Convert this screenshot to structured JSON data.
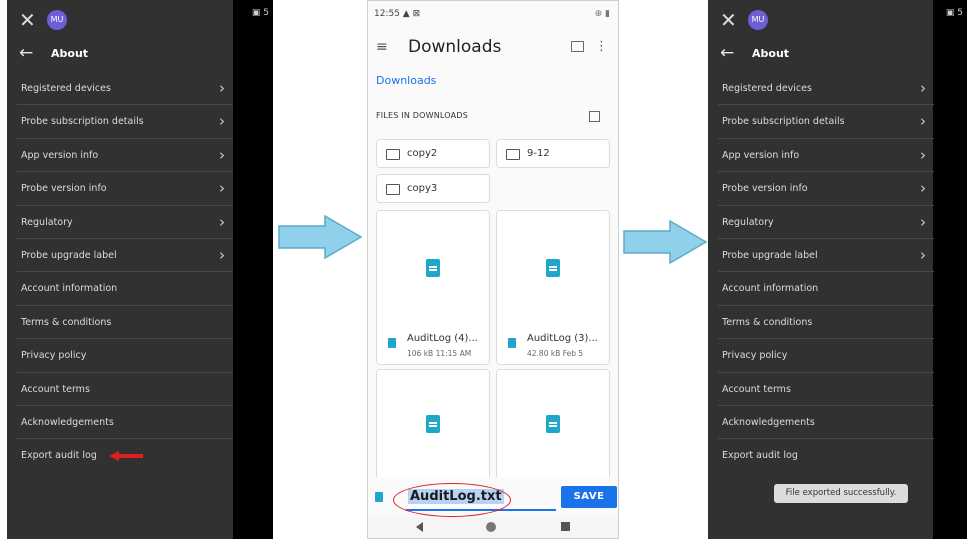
{
  "left_phone": {
    "avatar": "MU",
    "status_mini": "5",
    "title": "About",
    "items": [
      {
        "label": "Registered devices",
        "chevron": true
      },
      {
        "label": "Probe subscription details",
        "chevron": true
      },
      {
        "label": "App version info",
        "chevron": true
      },
      {
        "label": "Probe version info",
        "chevron": true
      },
      {
        "label": "Regulatory",
        "chevron": true
      },
      {
        "label": "Probe upgrade label",
        "chevron": true
      },
      {
        "label": "Account information",
        "chevron": false
      },
      {
        "label": "Terms & conditions",
        "chevron": false
      },
      {
        "label": "Privacy policy",
        "chevron": false
      },
      {
        "label": "Account terms",
        "chevron": false
      },
      {
        "label": "Acknowledgements",
        "chevron": false
      },
      {
        "label": "Export audit log",
        "chevron": false
      }
    ]
  },
  "middle_phone": {
    "time": "12:55",
    "status_right": "⊕ ▮",
    "title": "Downloads",
    "breadcrumb": "Downloads",
    "section_label": "FILES IN DOWNLOADS",
    "folders": [
      "copy2",
      "9-12",
      "copy3"
    ],
    "files": [
      {
        "name": "AuditLog (4)...",
        "meta": "106 kB 11:15 AM"
      },
      {
        "name": "AuditLog (3)...",
        "meta": "42.80 kB Feb 5"
      }
    ],
    "filename_input": "AuditLog.txt",
    "save_label": "SAVE"
  },
  "right_phone": {
    "avatar": "MU",
    "status_mini": "5",
    "title": "About",
    "items": [
      {
        "label": "Registered devices",
        "chevron": true
      },
      {
        "label": "Probe subscription details",
        "chevron": true
      },
      {
        "label": "App version info",
        "chevron": true
      },
      {
        "label": "Probe version info",
        "chevron": true
      },
      {
        "label": "Regulatory",
        "chevron": true
      },
      {
        "label": "Probe upgrade label",
        "chevron": true
      },
      {
        "label": "Account information",
        "chevron": false
      },
      {
        "label": "Terms & conditions",
        "chevron": false
      },
      {
        "label": "Privacy policy",
        "chevron": false
      },
      {
        "label": "Account terms",
        "chevron": false
      },
      {
        "label": "Acknowledgements",
        "chevron": false
      },
      {
        "label": "Export audit log",
        "chevron": false
      }
    ],
    "toast": "File exported successfully."
  },
  "colors": {
    "dark_bg": "#313131",
    "accent_blue": "#1a73e8",
    "annotation_red": "#e02020",
    "arrow_blue": "#8fd0ea",
    "doc_icon": "#1fa6c8"
  }
}
